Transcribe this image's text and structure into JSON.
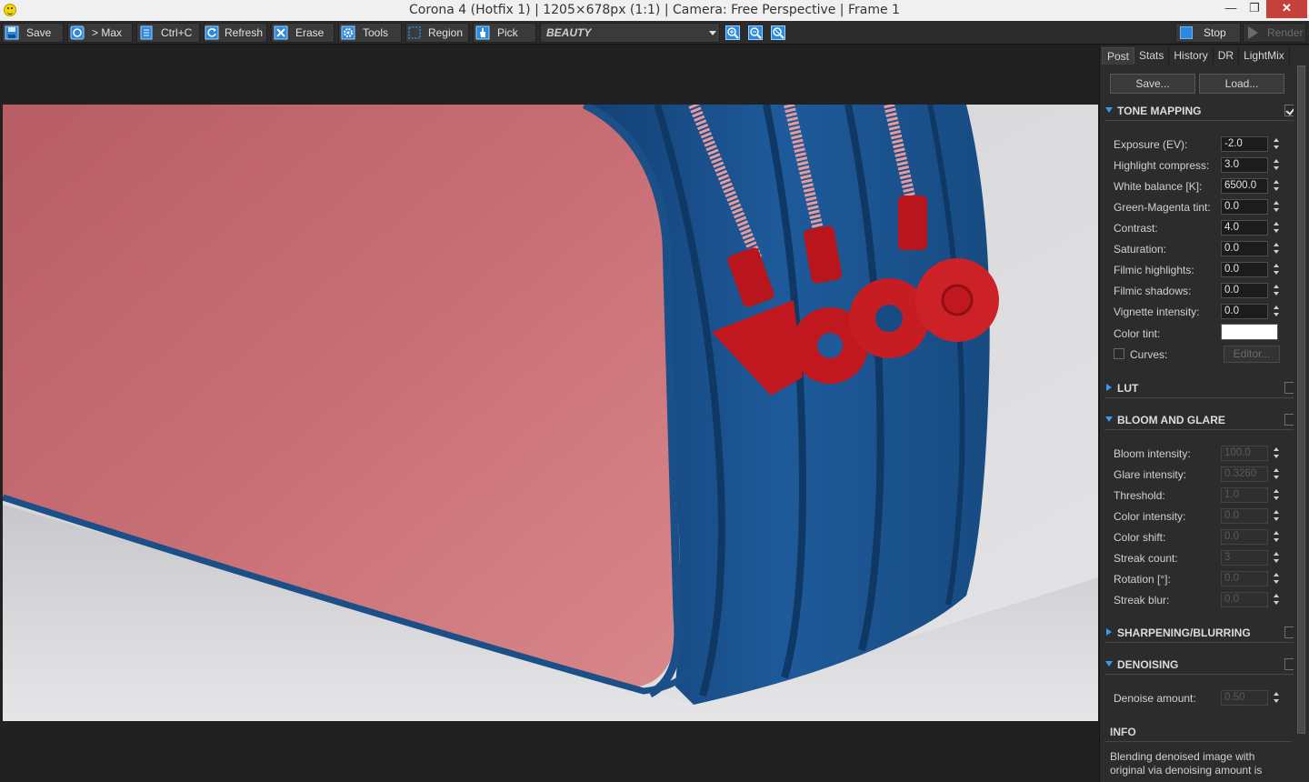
{
  "window": {
    "title": "Corona 4 (Hotfix 1) | 1205×678px (1:1) | Camera: Free Perspective | Frame 1",
    "controls": {
      "minimize": "—",
      "maximize": "❐",
      "close": "✕"
    }
  },
  "toolbar": {
    "save": "Save",
    "to_max": "> Max",
    "ctrl_c": "Ctrl+C",
    "refresh": "Refresh",
    "erase": "Erase",
    "tools": "Tools",
    "region": "Region",
    "pick": "Pick",
    "render_element": "BEAUTY",
    "stop": "Stop",
    "render": "Render"
  },
  "panel": {
    "tabs": [
      "Post",
      "Stats",
      "History",
      "DR",
      "LightMix"
    ],
    "active_tab": "Post",
    "save_button": "Save...",
    "load_button": "Load...",
    "tone_mapping": {
      "title": "TONE MAPPING",
      "enabled": true,
      "params": [
        {
          "label": "Exposure (EV):",
          "value": "-2.0"
        },
        {
          "label": "Highlight compress:",
          "value": "3.0"
        },
        {
          "label": "White balance [K]:",
          "value": "6500.0"
        },
        {
          "label": "Green-Magenta tint:",
          "value": "0.0"
        },
        {
          "label": "Contrast:",
          "value": "4.0"
        },
        {
          "label": "Saturation:",
          "value": "0.0"
        },
        {
          "label": "Filmic highlights:",
          "value": "0.0"
        },
        {
          "label": "Filmic shadows:",
          "value": "0.0"
        },
        {
          "label": "Vignette intensity:",
          "value": "0.0"
        }
      ],
      "color_tint_label": "Color tint:",
      "color_tint": "#ffffff",
      "curves_label": "Curves:",
      "editor_label": "Editor..."
    },
    "lut": {
      "title": "LUT",
      "enabled": false
    },
    "bloom_glare": {
      "title": "BLOOM AND GLARE",
      "enabled": false,
      "params": [
        {
          "label": "Bloom intensity:",
          "value": "100.0"
        },
        {
          "label": "Glare intensity:",
          "value": "0.3260"
        },
        {
          "label": "Threshold:",
          "value": "1.0"
        },
        {
          "label": "Color intensity:",
          "value": "0.0"
        },
        {
          "label": "Color shift:",
          "value": "0.0"
        },
        {
          "label": "Streak count:",
          "value": "3"
        },
        {
          "label": "Rotation [°]:",
          "value": "0.0"
        },
        {
          "label": "Streak blur:",
          "value": "0.0"
        }
      ]
    },
    "sharpening": {
      "title": "SHARPENING/BLURRING",
      "enabled": false
    },
    "denoising": {
      "title": "DENOISING",
      "enabled": false,
      "params": [
        {
          "label": "Denoise amount:",
          "value": "0.50"
        }
      ]
    },
    "info": {
      "title": "INFO",
      "text": "Blending denoised image with original via denoising amount is"
    }
  },
  "colors": {
    "accent": "#2a8ae2",
    "case_pink": "#c3676d",
    "case_blue": "#1b5290",
    "zipper_red": "#c0181e"
  }
}
